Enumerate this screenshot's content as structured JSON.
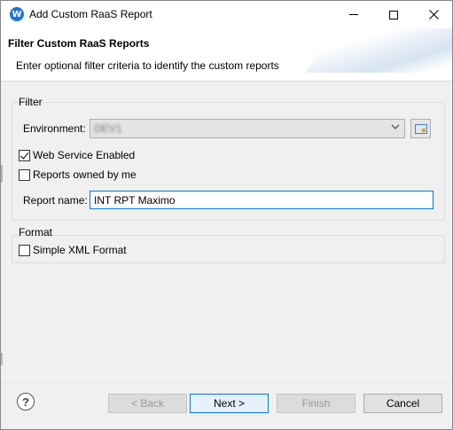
{
  "window": {
    "title": "Add Custom RaaS Report",
    "icon_letter": "W",
    "icon": "workday-app-icon",
    "controls": [
      "minimize-icon",
      "maximize-icon",
      "close-icon"
    ]
  },
  "banner": {
    "title": "Filter Custom RaaS Reports",
    "description": "Enter optional filter criteria to identify the custom reports"
  },
  "filter": {
    "legend": "Filter",
    "environment_label": "Environment:",
    "environment_value": "DEV1",
    "web_service_label": "Web Service Enabled",
    "web_service_checked": true,
    "owned_by_me_label": "Reports owned by me",
    "owned_by_me_checked": false,
    "report_name_label": "Report name:",
    "report_name_value": "INT RPT Maximo"
  },
  "format": {
    "legend": "Format",
    "simple_xml_label": "Simple XML Format",
    "simple_xml_checked": false
  },
  "buttons": {
    "help": "?",
    "back": "< Back",
    "next": "Next >",
    "finish": "Finish",
    "cancel": "Cancel"
  },
  "colors": {
    "accent": "#0078d7",
    "window_bg": "#f0f0f0",
    "app_icon": "#1d74d6"
  }
}
